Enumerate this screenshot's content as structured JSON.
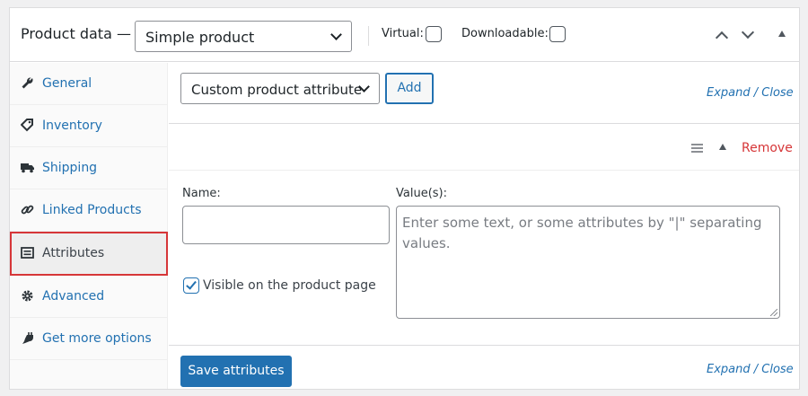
{
  "header": {
    "title": "Product data —",
    "product_type": "Simple product",
    "virtual_label": "Virtual:",
    "downloadable_label": "Downloadable:"
  },
  "sidebar": {
    "items": [
      {
        "label": "General",
        "icon": "wrench-icon"
      },
      {
        "label": "Inventory",
        "icon": "tag-icon"
      },
      {
        "label": "Shipping",
        "icon": "truck-icon"
      },
      {
        "label": "Linked Products",
        "icon": "link-icon"
      },
      {
        "label": "Attributes",
        "icon": "list-view-icon",
        "active": true
      },
      {
        "label": "Advanced",
        "icon": "gear-icon"
      },
      {
        "label": "Get more options",
        "icon": "plugin-icon"
      }
    ]
  },
  "main": {
    "attribute_select": "Custom product attribute",
    "add_label": "Add",
    "expand_close_top": "Expand / Close",
    "remove_label": "Remove",
    "name_label": "Name:",
    "name_value": "",
    "values_label": "Value(s):",
    "values_placeholder": "Enter some text, or some attributes by \"|\" separating values.",
    "visible_label": "Visible on the product page",
    "visible_checked": true,
    "save_label": "Save attributes",
    "expand_close_bottom": "Expand / Close"
  },
  "colors": {
    "accent": "#2271b1",
    "danger": "#d63638",
    "active_outline": "#d63638"
  }
}
